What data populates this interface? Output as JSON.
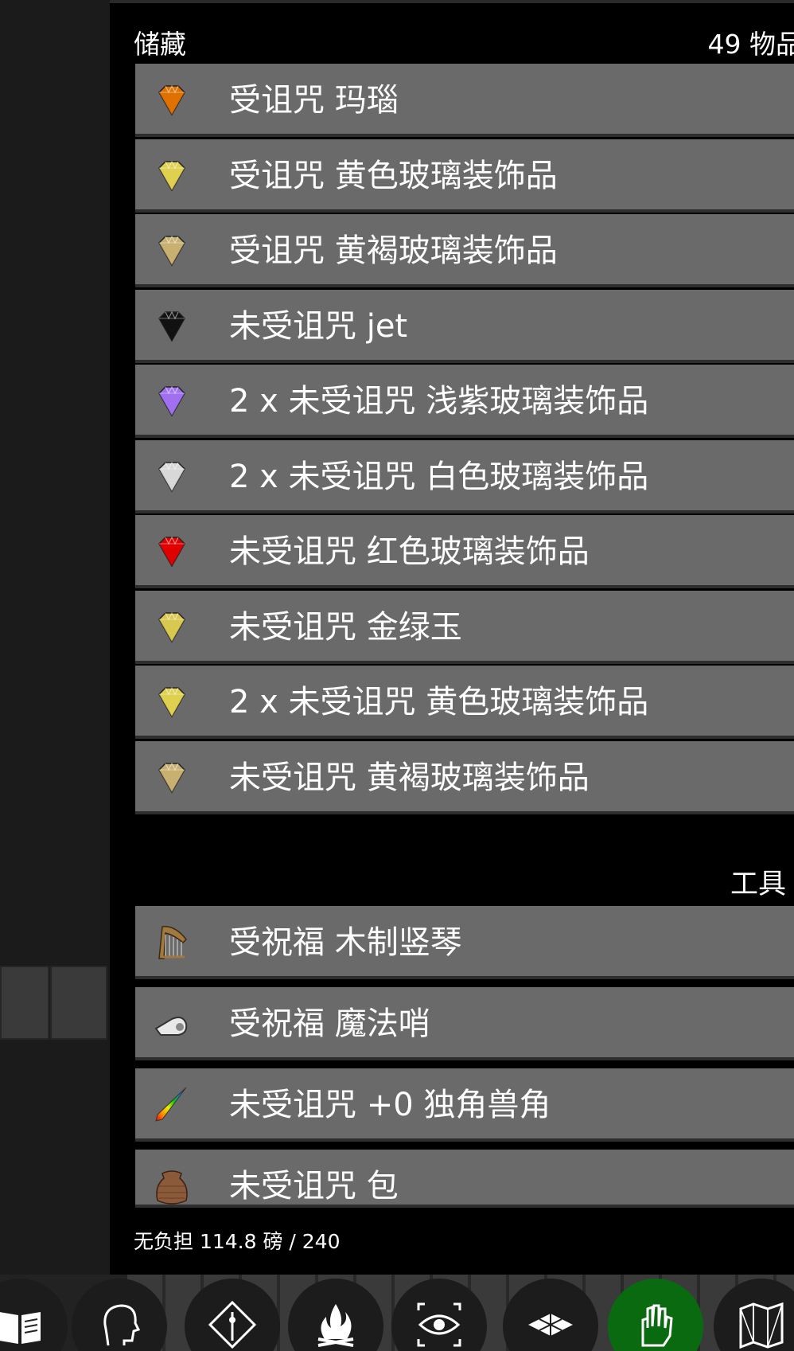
{
  "inventory": {
    "title": "储藏",
    "count": "49 物品",
    "gem_items": [
      {
        "label": "受诅咒 玛瑙",
        "icon": "orange-gem-icon",
        "color": "#e07000"
      },
      {
        "label": "受诅咒 黄色玻璃装饰品",
        "icon": "yellow-gem-icon",
        "color": "#e0d050"
      },
      {
        "label": "受诅咒 黄褐玻璃装饰品",
        "icon": "yellowish-brown-gem-icon",
        "color": "#c8b070"
      },
      {
        "label": "未受诅咒 jet",
        "icon": "black-gem-icon",
        "color": "#111111"
      },
      {
        "label": "2 x 未受诅咒 浅紫玻璃装饰品",
        "icon": "violet-gem-icon",
        "color": "#a070f0"
      },
      {
        "label": "2 x 未受诅咒 白色玻璃装饰品",
        "icon": "white-gem-icon",
        "color": "#d8d8d8"
      },
      {
        "label": "未受诅咒 红色玻璃装饰品",
        "icon": "red-gem-icon",
        "color": "#e00000"
      },
      {
        "label": "未受诅咒 金绿玉",
        "icon": "chrysoberyl-gem-icon",
        "color": "#d8c850"
      },
      {
        "label": "2 x 未受诅咒 黄色玻璃装饰品",
        "icon": "yellow-gem-icon",
        "color": "#e0d050"
      },
      {
        "label": "未受诅咒 黄褐玻璃装饰品",
        "icon": "yellowish-brown-gem-icon",
        "color": "#c8b070"
      }
    ],
    "tools_section": "工具",
    "tool_items": [
      {
        "label": "受祝福 木制竖琴",
        "icon": "harp-icon"
      },
      {
        "label": "受祝福 魔法哨",
        "icon": "whistle-icon"
      },
      {
        "label": "未受诅咒 +0 独角兽角",
        "icon": "unicorn-horn-icon"
      },
      {
        "label": "未受诅咒 包",
        "icon": "sack-icon"
      }
    ],
    "status": "无负担 114.8 磅 / 240"
  },
  "bottom_bar": [
    {
      "name": "spellbook-button",
      "icon": "open-book-icon"
    },
    {
      "name": "character-button",
      "icon": "head-profile-icon"
    },
    {
      "name": "skills-button",
      "icon": "diamond-sigil-icon"
    },
    {
      "name": "rest-button",
      "icon": "campfire-icon"
    },
    {
      "name": "look-button",
      "icon": "eye-icon"
    },
    {
      "name": "map-floor-button",
      "icon": "floor-tiles-icon"
    },
    {
      "name": "inventory-button",
      "icon": "hand-icon",
      "active": true
    },
    {
      "name": "dungeon-map-button",
      "icon": "folded-map-icon"
    }
  ],
  "colors": {
    "row_bg": "#6a6a6a",
    "panel_bg": "#000000",
    "active_button": "#0a6a10"
  }
}
